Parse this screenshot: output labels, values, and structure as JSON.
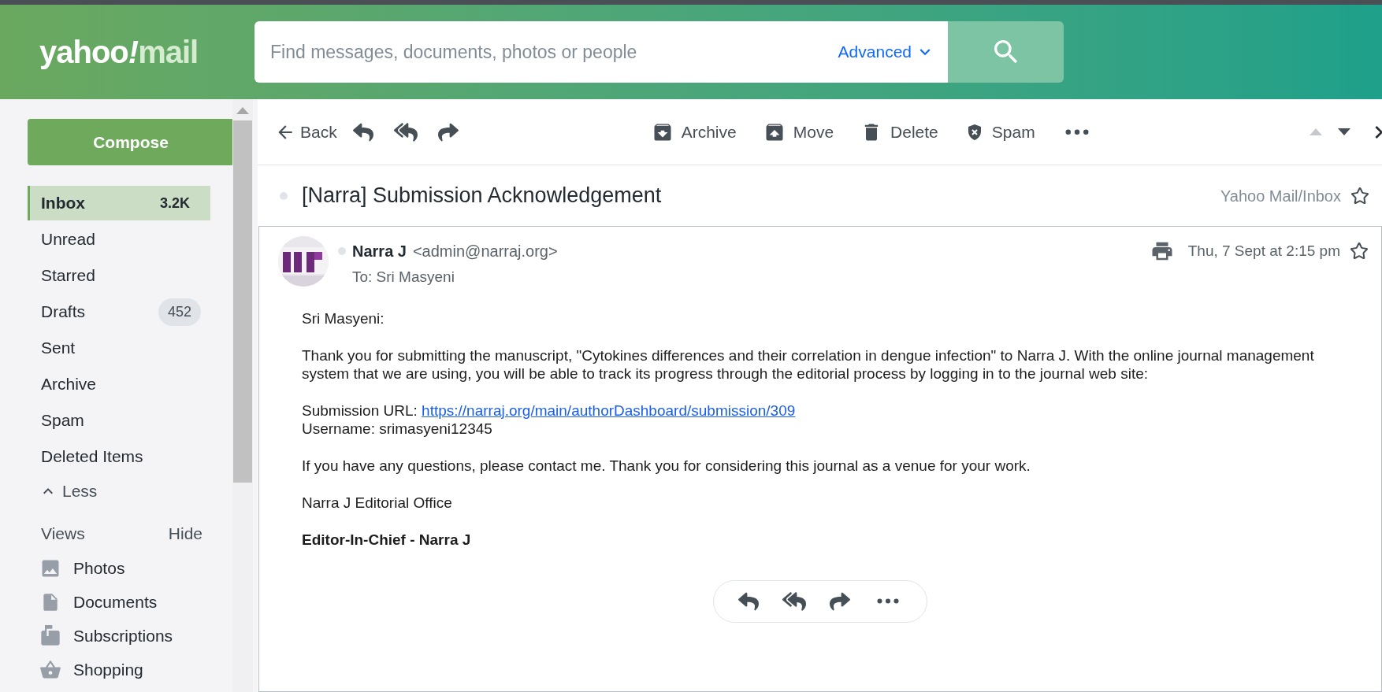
{
  "header": {
    "logo": {
      "main": "yahoo",
      "mark": "!",
      "product": "mail"
    },
    "search": {
      "placeholder": "Find messages, documents, photos or people",
      "advanced": "Advanced"
    }
  },
  "sidebar": {
    "compose": "Compose",
    "folders": [
      {
        "label": "Inbox",
        "count": "3.2K",
        "kind": "plain",
        "selected": true
      },
      {
        "label": "Unread",
        "selected": false
      },
      {
        "label": "Starred",
        "selected": false
      },
      {
        "label": "Drafts",
        "count": "452",
        "kind": "pill",
        "selected": false
      },
      {
        "label": "Sent",
        "selected": false
      },
      {
        "label": "Archive",
        "selected": false
      },
      {
        "label": "Spam",
        "selected": false
      },
      {
        "label": "Deleted Items",
        "selected": false
      }
    ],
    "less": "Less",
    "views": {
      "title": "Views",
      "toggle": "Hide",
      "items": [
        {
          "kind": "photos",
          "label": "Photos"
        },
        {
          "kind": "documents",
          "label": "Documents"
        },
        {
          "kind": "subscriptions",
          "label": "Subscriptions"
        },
        {
          "kind": "shopping",
          "label": "Shopping"
        }
      ]
    }
  },
  "toolbar": {
    "back": "Back",
    "actions": [
      {
        "kind": "archive",
        "label": "Archive"
      },
      {
        "kind": "move",
        "label": "Move"
      },
      {
        "kind": "delete",
        "label": "Delete"
      },
      {
        "kind": "spam",
        "label": "Spam"
      }
    ]
  },
  "message": {
    "subject": "[Narra] Submission Acknowledgement",
    "folder": "Yahoo Mail/Inbox",
    "sender_name": "Narra J",
    "sender_email": "<admin@narraj.org>",
    "to": "To: Sri Masyeni",
    "date": "Thu, 7 Sept at 2:15 pm",
    "body": [
      {
        "kind": "text",
        "text": "Sri Masyeni:"
      },
      {
        "kind": "text",
        "text": "Thank you for submitting the manuscript, \"Cytokines differences and their correlation in dengue infection\" to Narra J. With the online journal management system that we are using, you will be able to track its progress through the editorial process by logging in to the journal web site:"
      },
      {
        "kind": "details",
        "lines": [
          {
            "label": "Submission URL: ",
            "link": "https://narraj.org/main/authorDashboard/submission/309"
          },
          {
            "label": "Username: srimasyeni12345"
          }
        ]
      },
      {
        "kind": "text",
        "text": "If you have any questions, please contact me. Thank you for considering this journal as a venue for your work."
      },
      {
        "kind": "text",
        "text": "Narra J Editorial Office"
      },
      {
        "kind": "bold",
        "text": "Editor-In-Chief - Narra J"
      }
    ]
  }
}
